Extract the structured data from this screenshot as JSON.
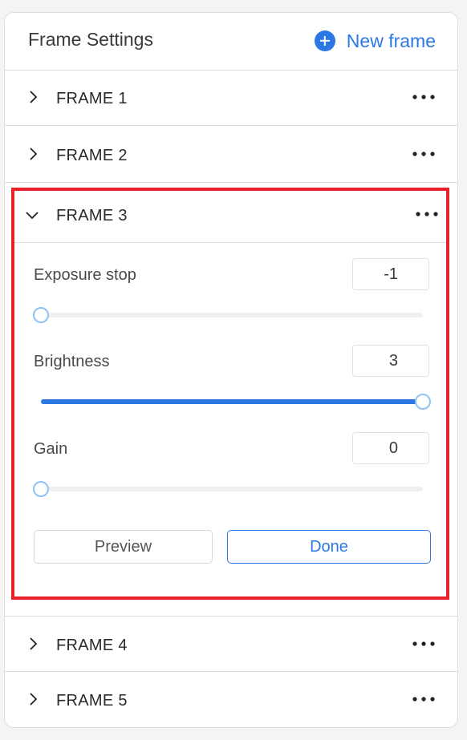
{
  "header": {
    "title": "Frame Settings",
    "new_frame_label": "New frame",
    "accent_color": "#2b78e4"
  },
  "frames": [
    {
      "label": "FRAME 1",
      "expanded": false
    },
    {
      "label": "FRAME 2",
      "expanded": false
    },
    {
      "label": "FRAME 3",
      "expanded": true
    },
    {
      "label": "FRAME 4",
      "expanded": false
    },
    {
      "label": "FRAME 5",
      "expanded": false
    }
  ],
  "settings": {
    "exposure": {
      "label": "Exposure stop",
      "value": "-1",
      "level": 0.0
    },
    "brightness": {
      "label": "Brightness",
      "value": "3",
      "level": 1.0
    },
    "gain": {
      "label": "Gain",
      "value": "0",
      "level": 0.0
    }
  },
  "actions": {
    "preview_label": "Preview",
    "done_label": "Done"
  },
  "icons": {
    "collapsed": "chevron-right-icon",
    "expanded": "chevron-down-icon",
    "menu": "more-horizontal-icon",
    "add": "plus-circle-icon"
  },
  "highlight_color": "#e8202a"
}
